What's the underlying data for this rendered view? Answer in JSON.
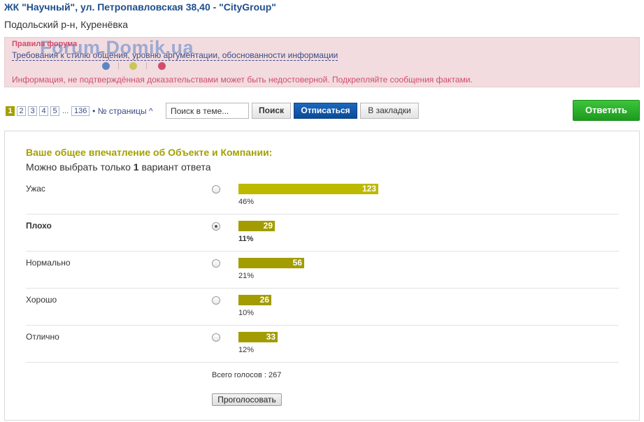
{
  "header": {
    "title": "ЖК \"Научный\", ул. Петропавловская 38,40 - \"CityGroup\"",
    "subtitle": "Подольский р-н, Куренёвка"
  },
  "rules": {
    "heading": "Правила форума",
    "link_text": "Требования к стилю общения, уровню аргументации, обоснованности информации",
    "warning": "Информация, не подтверждённая доказательствами может быть недостоверной. Подкрепляйте сообщения фактами."
  },
  "watermark": {
    "text": "Forum.Domik.ua",
    "dot_colors": [
      "#5b86c4",
      "#c9c659",
      "#d24b6b"
    ]
  },
  "pagination": {
    "pages": [
      "1",
      "2",
      "3",
      "4",
      "5"
    ],
    "active_page": "1",
    "ellipsis": "...",
    "last_page": "136",
    "toggle_label": "• № страницы ^"
  },
  "toolbar": {
    "search_placeholder": "Поиск в теме...",
    "search_label": "Поиск",
    "unsubscribe_label": "Отписаться",
    "bookmark_label": "В закладки",
    "reply_label": "Ответить"
  },
  "poll": {
    "question": "Ваше общее впечатление об Объекте и Компании:",
    "hint_before": "Можно выбрать только ",
    "hint_count": "1",
    "hint_after": " вариант ответа",
    "options": [
      {
        "label": "Ужас",
        "votes": "123",
        "percent": "46%",
        "selected": false
      },
      {
        "label": "Плохо",
        "votes": "29",
        "percent": "11%",
        "selected": true
      },
      {
        "label": "Нормально",
        "votes": "56",
        "percent": "21%",
        "selected": false
      },
      {
        "label": "Хорошо",
        "votes": "26",
        "percent": "10%",
        "selected": false
      },
      {
        "label": "Отлично",
        "votes": "33",
        "percent": "12%",
        "selected": false
      }
    ],
    "total_label": "Всего голосов : 267",
    "vote_button": "Проголосовать"
  },
  "colors": {
    "accent": "#a4a000",
    "bar_light": "#bcb900",
    "bar_dark": "#a39c00",
    "link": "#1e4e8c",
    "reply": "#2aa92a",
    "unsubscribe": "#0b4b97"
  }
}
